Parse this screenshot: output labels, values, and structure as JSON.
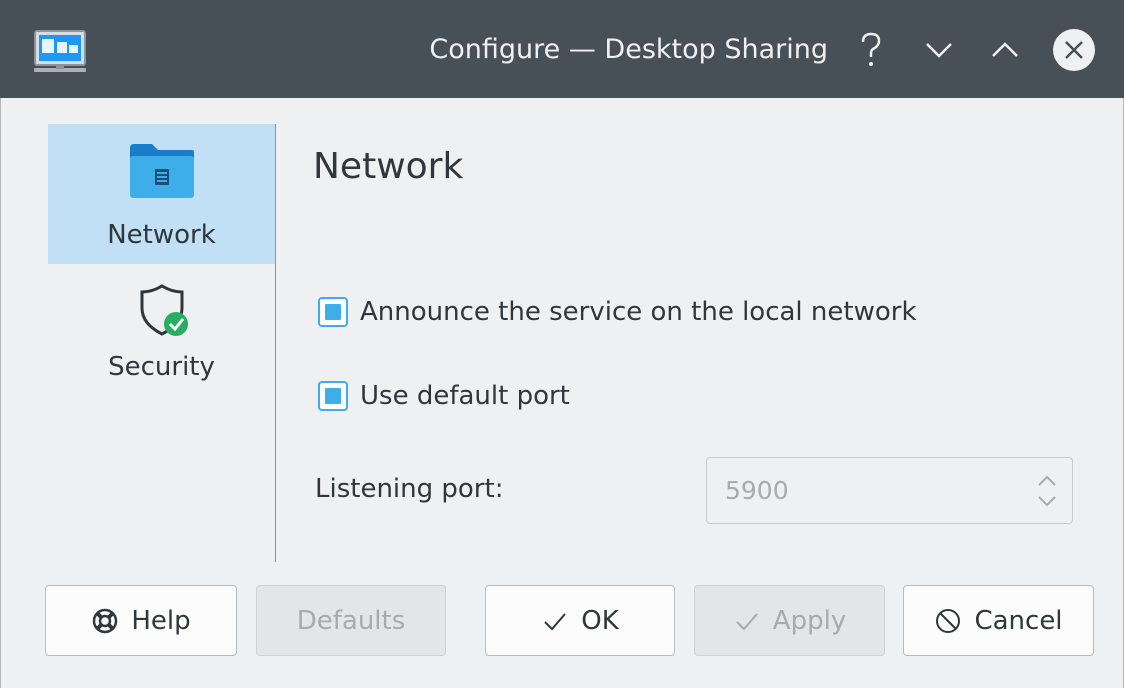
{
  "window": {
    "title": "Configure — Desktop Sharing",
    "controls": [
      "help-icon",
      "minimize-icon",
      "maximize-icon",
      "close-icon"
    ]
  },
  "sidebar": {
    "items": [
      {
        "label": "Network",
        "icon": "network-folder-icon",
        "active": true
      },
      {
        "label": "Security",
        "icon": "shield-check-icon",
        "active": false
      }
    ]
  },
  "main": {
    "page_title": "Network",
    "announce_checkbox": {
      "label": "Announce the service on the local network",
      "checked": true
    },
    "default_port_checkbox": {
      "label": "Use default port",
      "checked": true
    },
    "listening_port": {
      "label": "Listening port:",
      "value": "5900",
      "enabled": false
    }
  },
  "buttons": {
    "help": "Help",
    "defaults": "Defaults",
    "ok": "OK",
    "apply": "Apply",
    "cancel": "Cancel"
  },
  "colors": {
    "titlebar": "#475057",
    "accent": "#3daee9",
    "selection": "#c2e0f5",
    "background": "#eff0f1",
    "text": "#31363b",
    "success": "#27ae60"
  }
}
